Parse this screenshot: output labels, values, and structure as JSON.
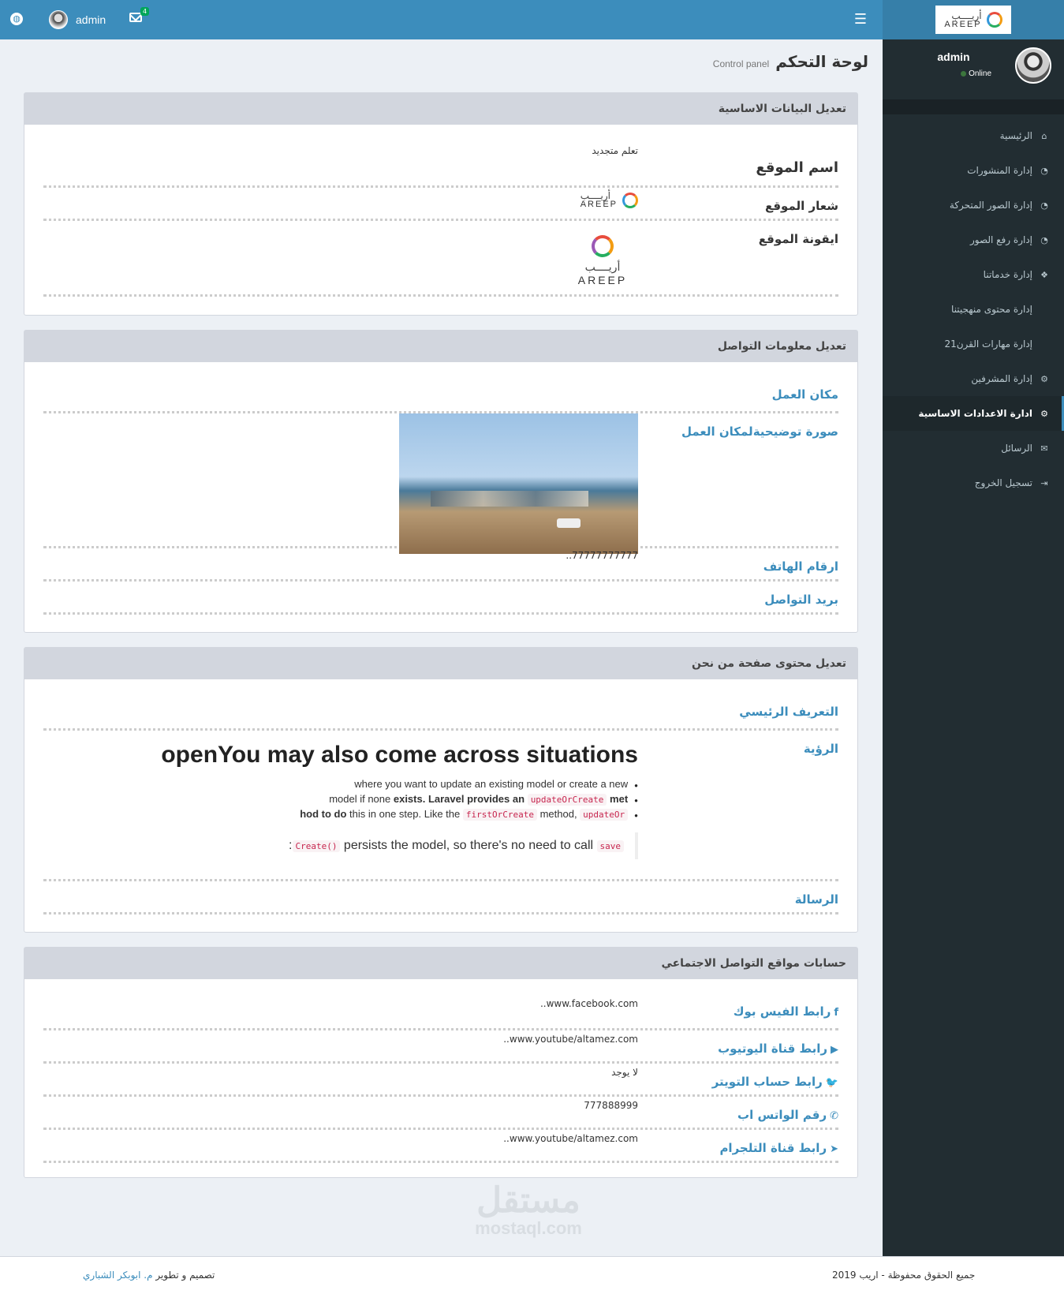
{
  "header": {
    "user_name": "admin",
    "mail_count": "4",
    "logo_ar": "أريــــب",
    "logo_en": "AREEP"
  },
  "sidebar": {
    "user_name": "admin",
    "status": "Online",
    "items": [
      {
        "label": "الرئيسية",
        "icon": "home-icon",
        "glyph": "⌂"
      },
      {
        "label": "إدارة المنشورات",
        "icon": "dashboard-icon",
        "glyph": "◔"
      },
      {
        "label": "إدارة الصور المتحركة",
        "icon": "dashboard-icon",
        "glyph": "◔"
      },
      {
        "label": "إدارة رفع الصور",
        "icon": "dashboard-icon",
        "glyph": "◔"
      },
      {
        "label": "إدارة خدماتنا",
        "icon": "cubes-icon",
        "glyph": "❖"
      },
      {
        "label": "إدارة محتوى منهجيتنا",
        "icon": "",
        "glyph": ""
      },
      {
        "label": "إدارة مهارات القرن21",
        "icon": "",
        "glyph": ""
      },
      {
        "label": "إدارة المشرفين",
        "icon": "cogs-icon",
        "glyph": "⚙"
      },
      {
        "label": "ادارة الاعدادات الاساسية",
        "icon": "cog-icon",
        "glyph": "⚙"
      },
      {
        "label": "الرسائل",
        "icon": "envelope-icon",
        "glyph": "✉"
      },
      {
        "label": "تسجيل الخروج",
        "icon": "sign-out-icon",
        "glyph": "⇥"
      }
    ]
  },
  "page": {
    "title": "لوحة التحكم",
    "subtitle": "Control panel"
  },
  "basic": {
    "heading": "تعديل البيانات الاساسية",
    "site_name_label": "اسم الموقع",
    "site_name_value": "تعلم متجديد",
    "logo_label": "شعار الموقع",
    "icon_label": "ايقونة الموقع"
  },
  "contact": {
    "heading": "تعديل معلومات التواصل",
    "workplace_label": "مكان العمل",
    "photo_label": "صورة توضيحيةلمكان العمل",
    "phones_label": "ارقام الهاتف",
    "phones_value": "77777777777..",
    "email_label": "بريد التواصل"
  },
  "about": {
    "heading": "تعديل محتوى صفحة من نحن",
    "intro_label": "التعريف الرئيسي",
    "vision_label": "الرؤية",
    "vision_title": "openYou may also come across situations",
    "bullet1": "where you want to update an existing model or create a new",
    "bullet2a": "model if none ",
    "bullet2b": "exists. Laravel provides an",
    "bullet2code": "updateOrCreate",
    "bullet2c": "met",
    "bullet3a": "hod to do",
    "bullet3b": " this in one step. Like the ",
    "bullet3code1": "firstOrCreate",
    "bullet3c": " method, ",
    "bullet3code2": "updateOr",
    "quote_code1": "Create()",
    "quote_text": " persists the model, so there's no need to call ",
    "quote_code2": "save",
    "quote_end": " :",
    "message_label": "الرسالة"
  },
  "social": {
    "heading": "حسابات مواقع التواصل الاجتماعي",
    "rows": [
      {
        "label": "رابط الفيس بوك",
        "value": "www.facebook.com..",
        "icon": "facebook-icon",
        "glyph": "f"
      },
      {
        "label": "رابط قناة اليوتيوب",
        "value": "www.youtube/altamez.com..",
        "icon": "youtube-icon",
        "glyph": "▶"
      },
      {
        "label": "رابط حساب التويتر",
        "value": "لا يوجد",
        "icon": "twitter-icon",
        "glyph": "🐦"
      },
      {
        "label": "رقم الواتس اب",
        "value": "777888999",
        "icon": "whatsapp-icon",
        "glyph": "✆"
      },
      {
        "label": "رابط قناة التلجرام",
        "value": "www.youtube/altamez.com..",
        "icon": "telegram-icon",
        "glyph": "➤"
      }
    ]
  },
  "footer": {
    "rights": "جميع الحقوق محفوظة - اريب 2019",
    "design_label": "تصميم و تطوير ",
    "designer": "م. ابوبكر الشباري"
  },
  "watermark": {
    "ar": "مستقل",
    "en": "mostaql.com"
  }
}
